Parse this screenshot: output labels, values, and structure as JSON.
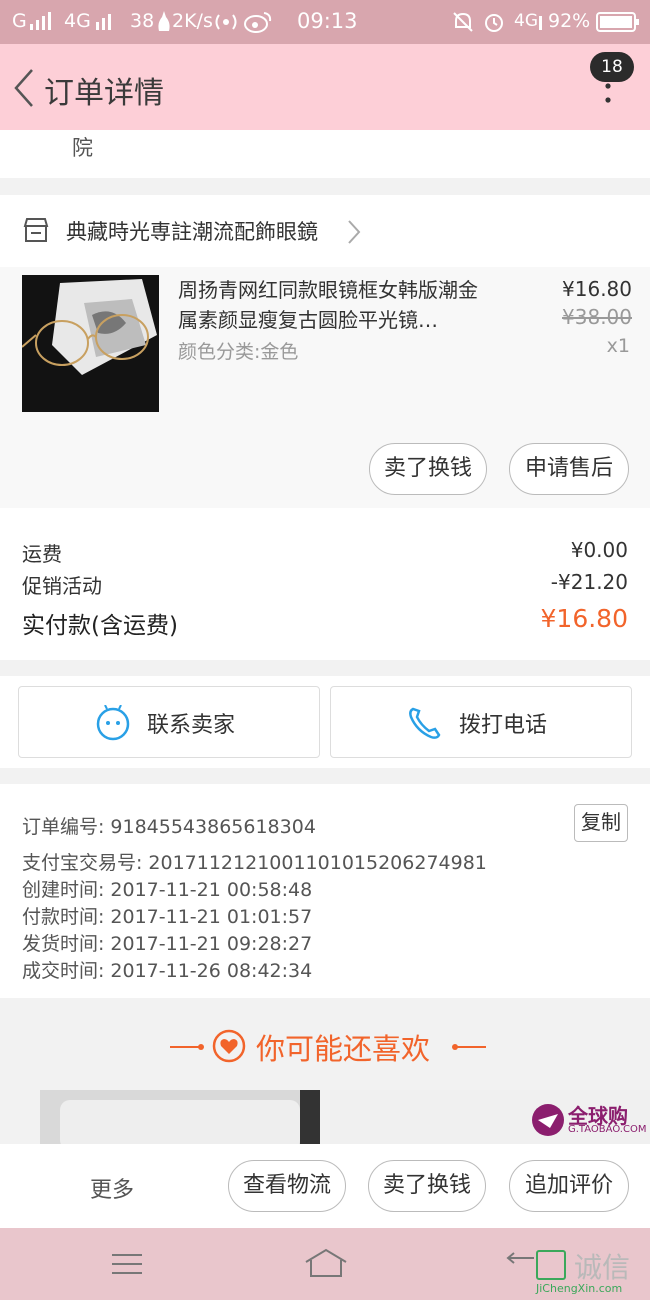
{
  "status_bar": {
    "signal": "G",
    "network": "4G",
    "speed_num": "38",
    "speed_unit": "2K/s",
    "time": "09:13",
    "network2": "4G",
    "battery": "92%"
  },
  "header": {
    "title": "订单详情",
    "badge_count": "18"
  },
  "address": {
    "partial_text": "院"
  },
  "shop": {
    "name": "典藏時光専註潮流配飾眼鏡"
  },
  "product": {
    "title": "周扬青网红同款眼镜框女韩版潮金属素颜显瘦复古圆脸平光镜…",
    "variant": "颜色分类:金色",
    "price": "¥16.80",
    "original_price": "¥38.00",
    "quantity": "x1",
    "sell_button": "卖了换钱",
    "aftersale_button": "申请售后"
  },
  "summary": {
    "shipping_label": "运费",
    "shipping_value": "¥0.00",
    "promo_label": "促销活动",
    "promo_value": "-¥21.20",
    "paid_label": "实付款(含运费)",
    "paid_value": "¥16.80"
  },
  "contact": {
    "seller_label": "联系卖家",
    "phone_label": "拨打电话"
  },
  "order_info": {
    "copy_button": "复制",
    "rows": [
      {
        "label": "订单编号:",
        "value": "91845543865618304"
      },
      {
        "label": "支付宝交易号:",
        "value": "2017112121001101015206274981"
      },
      {
        "label": "创建时间:",
        "value": "2017-11-21  00:58:48"
      },
      {
        "label": "付款时间:",
        "value": "2017-11-21  01:01:57"
      },
      {
        "label": "发货时间:",
        "value": "2017-11-21  09:28:27"
      },
      {
        "label": "成交时间:",
        "value": "2017-11-26  08:42:34"
      }
    ]
  },
  "recommend": {
    "title": "你可能还喜欢",
    "global_tag": "全球购",
    "global_sub": "G.TAOBAO.COM"
  },
  "bottom_bar": {
    "more": "更多",
    "logistics": "查看物流",
    "sell": "卖了换钱",
    "review": "追加评价"
  },
  "watermark": {
    "text": "诚信",
    "url": "JiChengXin.com"
  },
  "colors": {
    "header_bg": "#fdcfd7",
    "status_bg": "#d8a6ae",
    "accent_orange": "#f2642b",
    "nav_bg": "#e9c6cc"
  }
}
